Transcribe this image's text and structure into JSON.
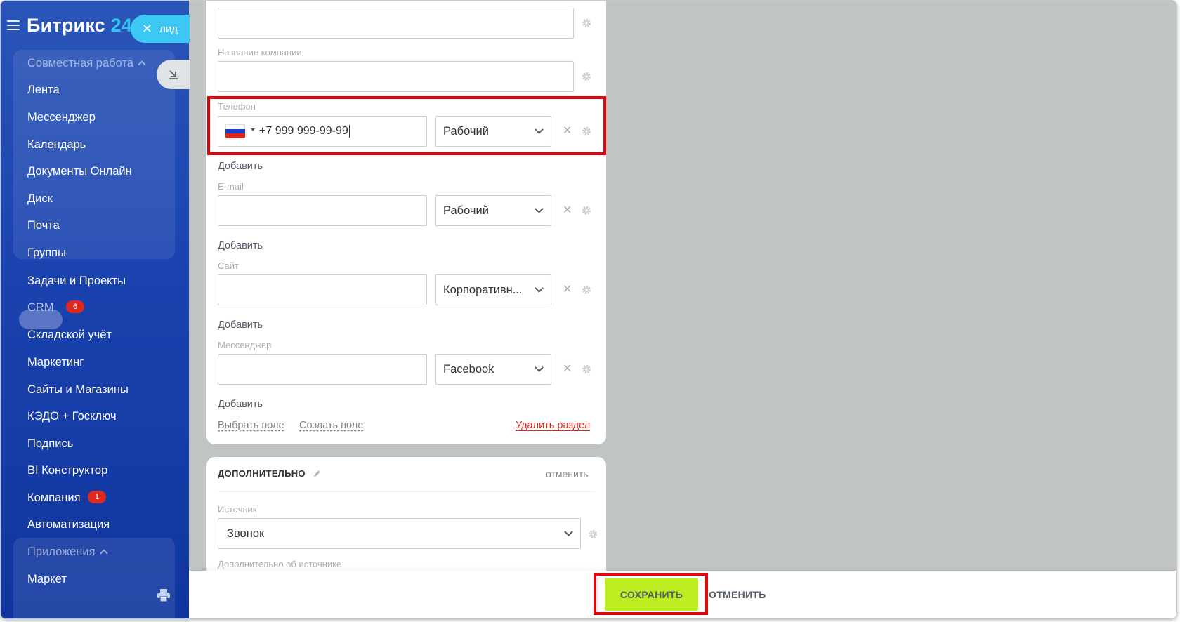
{
  "sidebar": {
    "logo_text": "Битрикс",
    "logo_num": "24",
    "lead_label": "лид",
    "group1_title": "Совместная работа",
    "group1_items": [
      "Лента",
      "Мессенджер",
      "Календарь",
      "Документы Онлайн",
      "Диск",
      "Почта",
      "Группы"
    ],
    "items": [
      "Задачи и Проекты",
      "CRM",
      "Складской учёт",
      "Маркетинг",
      "Сайты и Магазины",
      "КЭДО + Госключ",
      "Подпись",
      "BI Конструктор",
      "Компания",
      "Автоматизация"
    ],
    "crm_badge": "6",
    "company_badge": "1",
    "group2_title": "Приложения",
    "group2_items": [
      "Маркет"
    ]
  },
  "form": {
    "company_label": "Название компании",
    "phone_label": "Телефон",
    "phone_value": "+7 999 999-99-99",
    "phone_type": "Рабочий",
    "add_label": "Добавить",
    "email_label": "E-mail",
    "email_type": "Рабочий",
    "site_label": "Сайт",
    "site_type": "Корпоративн...",
    "messenger_label": "Мессенджер",
    "messenger_type": "Facebook",
    "choose_field": "Выбрать поле",
    "create_field": "Создать поле",
    "delete_section": "Удалить раздел"
  },
  "section2": {
    "title": "дополнительно",
    "cancel": "отменить",
    "source_label": "Источник",
    "source_value": "Звонок",
    "source_extra_label": "Дополнительно об источнике"
  },
  "footer": {
    "save": "СОХРАНИТЬ",
    "cancel": "ОТМЕНИТЬ"
  },
  "colors": {
    "sidebar_bg": "#1b44b0",
    "accent_cyan": "#3bc8f5",
    "save_green": "#bbed21",
    "highlight_red": "#e5060c",
    "badge_red": "#e0291e"
  }
}
